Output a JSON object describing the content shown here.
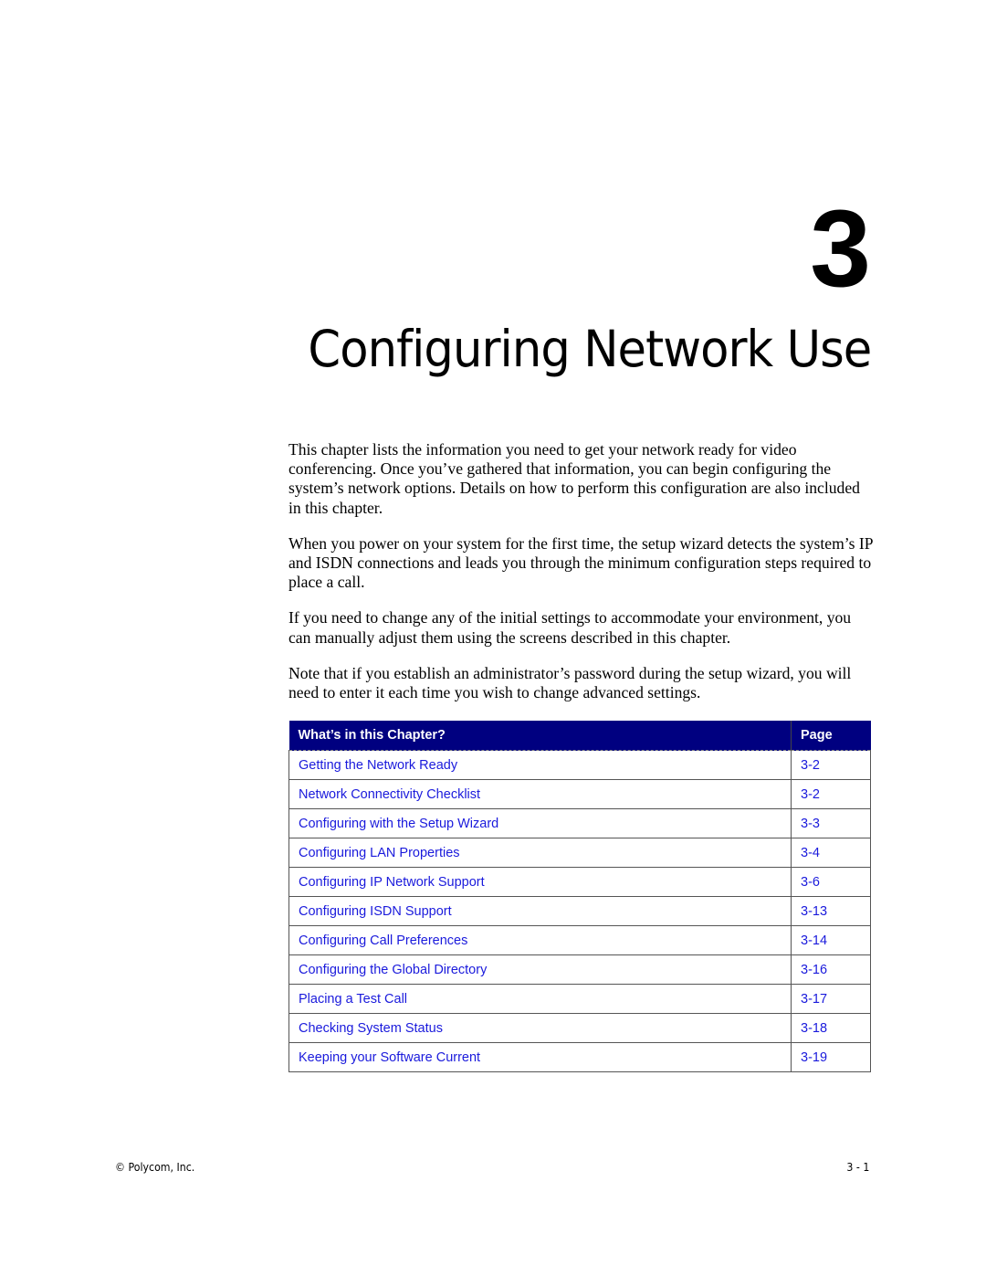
{
  "chapter": {
    "number": "3",
    "title": "Configuring Network Use"
  },
  "paragraphs": [
    "This chapter lists the information you need to get your network ready for video conferencing. Once you’ve gathered that information, you can begin configuring the system’s network options. Details on how to perform this configuration are also included in this chapter.",
    "When you power on your system for the first time, the setup wizard detects the system’s IP and ISDN connections and leads you through the minimum configuration steps required to place a call.",
    "If you need to change any of the initial settings to accommodate your environment, you can manually adjust them using the screens described in this chapter.",
    "Note that if you establish an administrator’s password during the setup wizard, you will need to enter it each time you wish to change advanced settings."
  ],
  "toc": {
    "header_topic": "What’s in this Chapter?",
    "header_page": "Page",
    "header_color": "#000080",
    "link_color": "#1a1adc",
    "rows": [
      {
        "topic": "Getting the Network Ready",
        "page": "3-2"
      },
      {
        "topic": "Network Connectivity Checklist",
        "page": "3-2"
      },
      {
        "topic": "Configuring with the Setup Wizard",
        "page": "3-3"
      },
      {
        "topic": "Configuring LAN Properties",
        "page": "3-4"
      },
      {
        "topic": "Configuring IP Network Support",
        "page": "3-6"
      },
      {
        "topic": "Configuring ISDN Support",
        "page": "3-13"
      },
      {
        "topic": "Configuring Call Preferences",
        "page": "3-14"
      },
      {
        "topic": "Configuring the Global Directory",
        "page": "3-16"
      },
      {
        "topic": "Placing a Test Call",
        "page": "3-17"
      },
      {
        "topic": "Checking System Status",
        "page": "3-18"
      },
      {
        "topic": "Keeping your Software Current",
        "page": "3-19"
      }
    ]
  },
  "footer": {
    "copyright": "© Polycom, Inc.",
    "page_number": "3 - 1"
  }
}
